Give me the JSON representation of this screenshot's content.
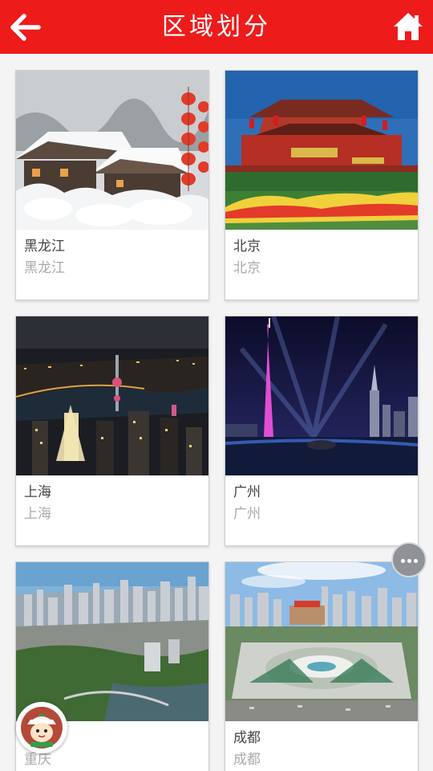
{
  "header": {
    "title": "区域划分",
    "back_icon": "arrow-left-icon",
    "home_icon": "home-icon",
    "color": "#ee1b1b"
  },
  "regions": [
    {
      "name": "黑龙江",
      "subtitle": "黑龙江",
      "image": "snow-village-photo"
    },
    {
      "name": "北京",
      "subtitle": "北京",
      "image": "tiananmen-photo"
    },
    {
      "name": "上海",
      "subtitle": "上海",
      "image": "shanghai-night-photo"
    },
    {
      "name": "广州",
      "subtitle": "广州",
      "image": "canton-tower-photo"
    },
    {
      "name": "重庆",
      "subtitle": "重庆",
      "image": "chongqing-skyline-photo"
    },
    {
      "name": "成都",
      "subtitle": "成都",
      "image": "chengdu-square-photo"
    }
  ],
  "floating": {
    "more_icon": "more-dots-icon",
    "avatar_icon": "assistant-avatar-icon"
  }
}
